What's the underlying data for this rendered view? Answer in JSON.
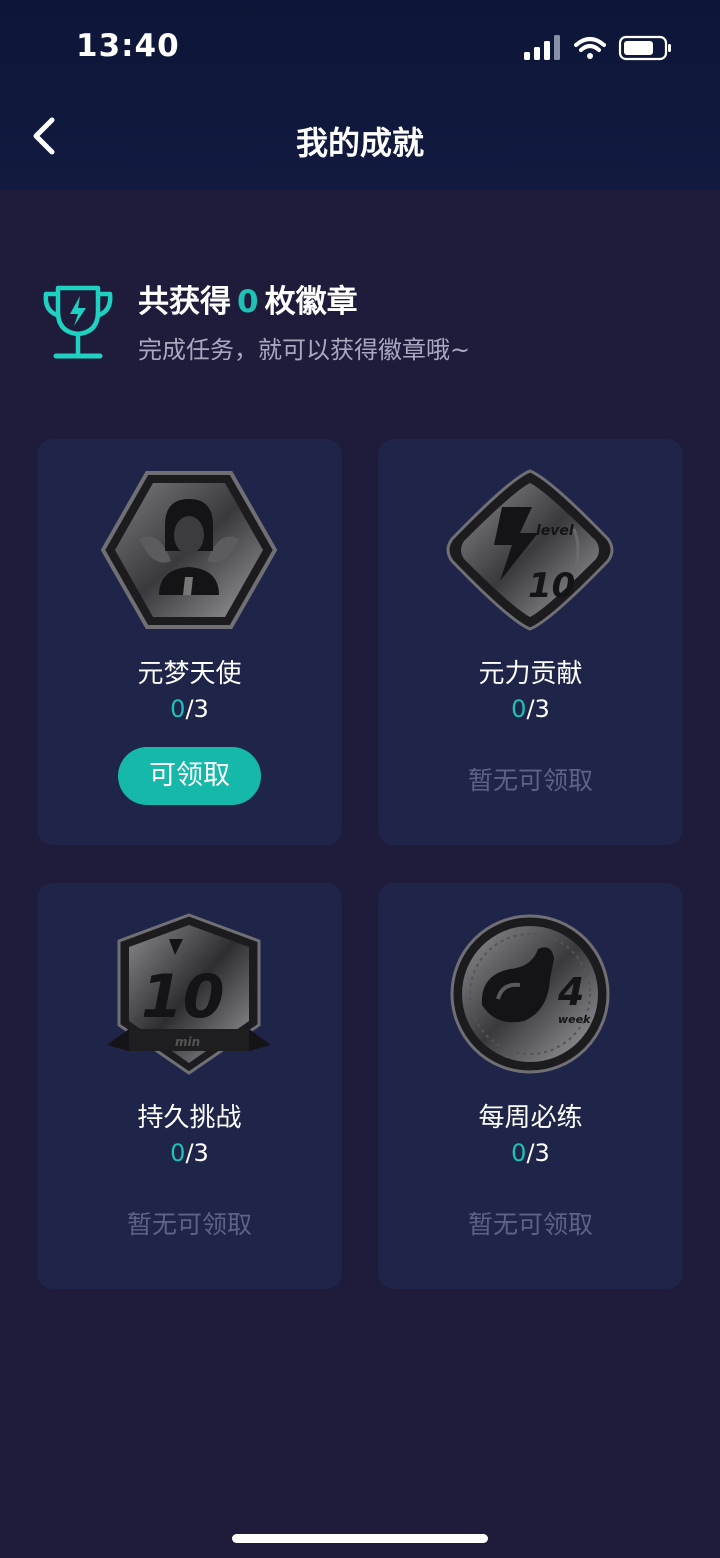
{
  "status": {
    "time": "13:40",
    "icons": [
      "signal-icon",
      "wifi-icon",
      "battery-icon"
    ]
  },
  "header": {
    "title": "我的成就",
    "back_icon": "chevron-left-icon"
  },
  "summary": {
    "prefix": "共获得",
    "count": "0",
    "suffix": "枚徽章",
    "subtitle": "完成任务，就可以获得徽章哦~",
    "icon": "trophy-icon"
  },
  "badges": [
    {
      "name": "元梦天使",
      "current": "0",
      "total": "/3",
      "action": "可领取",
      "claimable": true,
      "icon": "angel-badge-icon"
    },
    {
      "name": "元力贡献",
      "current": "0",
      "total": "/3",
      "action": "暂无可领取",
      "claimable": false,
      "icon": "level-10-badge-icon"
    },
    {
      "name": "持久挑战",
      "current": "0",
      "total": "/3",
      "action": "暂无可领取",
      "claimable": false,
      "icon": "10-min-badge-icon"
    },
    {
      "name": "每周必练",
      "current": "0",
      "total": "/3",
      "action": "暂无可领取",
      "claimable": false,
      "icon": "4-week-badge-icon"
    }
  ],
  "colors": {
    "background": "#1f1c3b",
    "header": "#0d1638",
    "card": "#1f2449",
    "accent": "#1fc1b6",
    "button": "#15b8a9",
    "muted_text": "#5e6285"
  }
}
